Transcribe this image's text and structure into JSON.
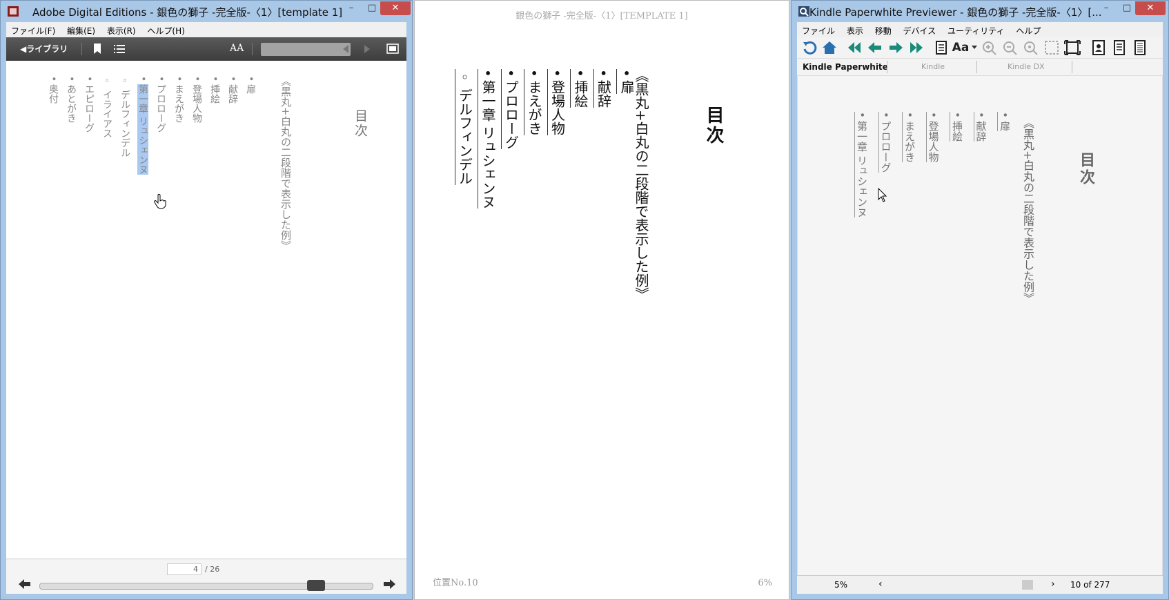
{
  "ade": {
    "title": "Adobe Digital Editions - 銀色の獅子 -完全版-〈1〉[template 1]",
    "menu": [
      "ファイル(F)",
      "編集(E)",
      "表示(R)",
      "ヘルプ(H)"
    ],
    "library_label": "◀ライブラリ",
    "font_button": "AA",
    "page_current": "4",
    "page_total": "/ 26",
    "toc_title": "目次",
    "toc_header": "《黒丸+白丸の二段階で表示した例》",
    "toc_items": [
      {
        "label": "扉",
        "mark": "•"
      },
      {
        "label": "献辞",
        "mark": "•"
      },
      {
        "label": "挿絵",
        "mark": "•"
      },
      {
        "label": "登場人物",
        "mark": "•"
      },
      {
        "label": "まえがき",
        "mark": "•"
      },
      {
        "label": "プロローグ",
        "mark": "•"
      },
      {
        "label": "第一章 リュシェンヌ",
        "mark": "•"
      },
      {
        "label": "デルフィンデル",
        "mark": "◦"
      },
      {
        "label": "イライアス",
        "mark": "◦"
      },
      {
        "label": "エピローグ",
        "mark": "•"
      },
      {
        "label": "あとがき",
        "mark": "•"
      },
      {
        "label": "奥付",
        "mark": "•"
      }
    ]
  },
  "mid": {
    "header": "銀色の獅子 -完全版-〈1〉[TEMPLATE 1]",
    "toc_title": "目次",
    "toc_header": "《黒丸+白丸の二段階で表示した例》",
    "toc_items": [
      {
        "label": "扉",
        "mark": "•"
      },
      {
        "label": "献辞",
        "mark": "•"
      },
      {
        "label": "挿絵",
        "mark": "•"
      },
      {
        "label": "登場人物",
        "mark": "•"
      },
      {
        "label": "まえがき",
        "mark": "•"
      },
      {
        "label": "プロローグ",
        "mark": "•"
      },
      {
        "label": "第一章 リュシェンヌ",
        "mark": "•"
      },
      {
        "label": "デルフィンデル",
        "mark": "◦"
      }
    ],
    "location": "位置No.10",
    "percent": "6%"
  },
  "kpv": {
    "title": "Kindle Paperwhite Previewer - 銀色の獅子 -完全版-〈1〉[...",
    "menu": [
      "ファイル",
      "表示",
      "移動",
      "デバイス",
      "ユーティリティ",
      "ヘルプ"
    ],
    "font_button": "Aa",
    "tabs": [
      "Kindle Paperwhite",
      "Kindle",
      "Kindle DX"
    ],
    "toc_title": "目次",
    "toc_header": "《黒丸+白丸の二段階で表示した例》",
    "toc_items": [
      {
        "label": "扉",
        "mark": "•"
      },
      {
        "label": "献辞",
        "mark": "•"
      },
      {
        "label": "挿絵",
        "mark": "•"
      },
      {
        "label": "登場人物",
        "mark": "•"
      },
      {
        "label": "まえがき",
        "mark": "•"
      },
      {
        "label": "プロローグ",
        "mark": "•"
      },
      {
        "label": "第一章 リュシェンヌ",
        "mark": "•"
      }
    ],
    "zoom": "5%",
    "position": "10 of 277"
  },
  "colors": {
    "window_frame": "#a9c7e6",
    "close_button": "#c74d4d",
    "highlight": "#a9c9f2",
    "kindle_teal": "#1a8a7a"
  }
}
